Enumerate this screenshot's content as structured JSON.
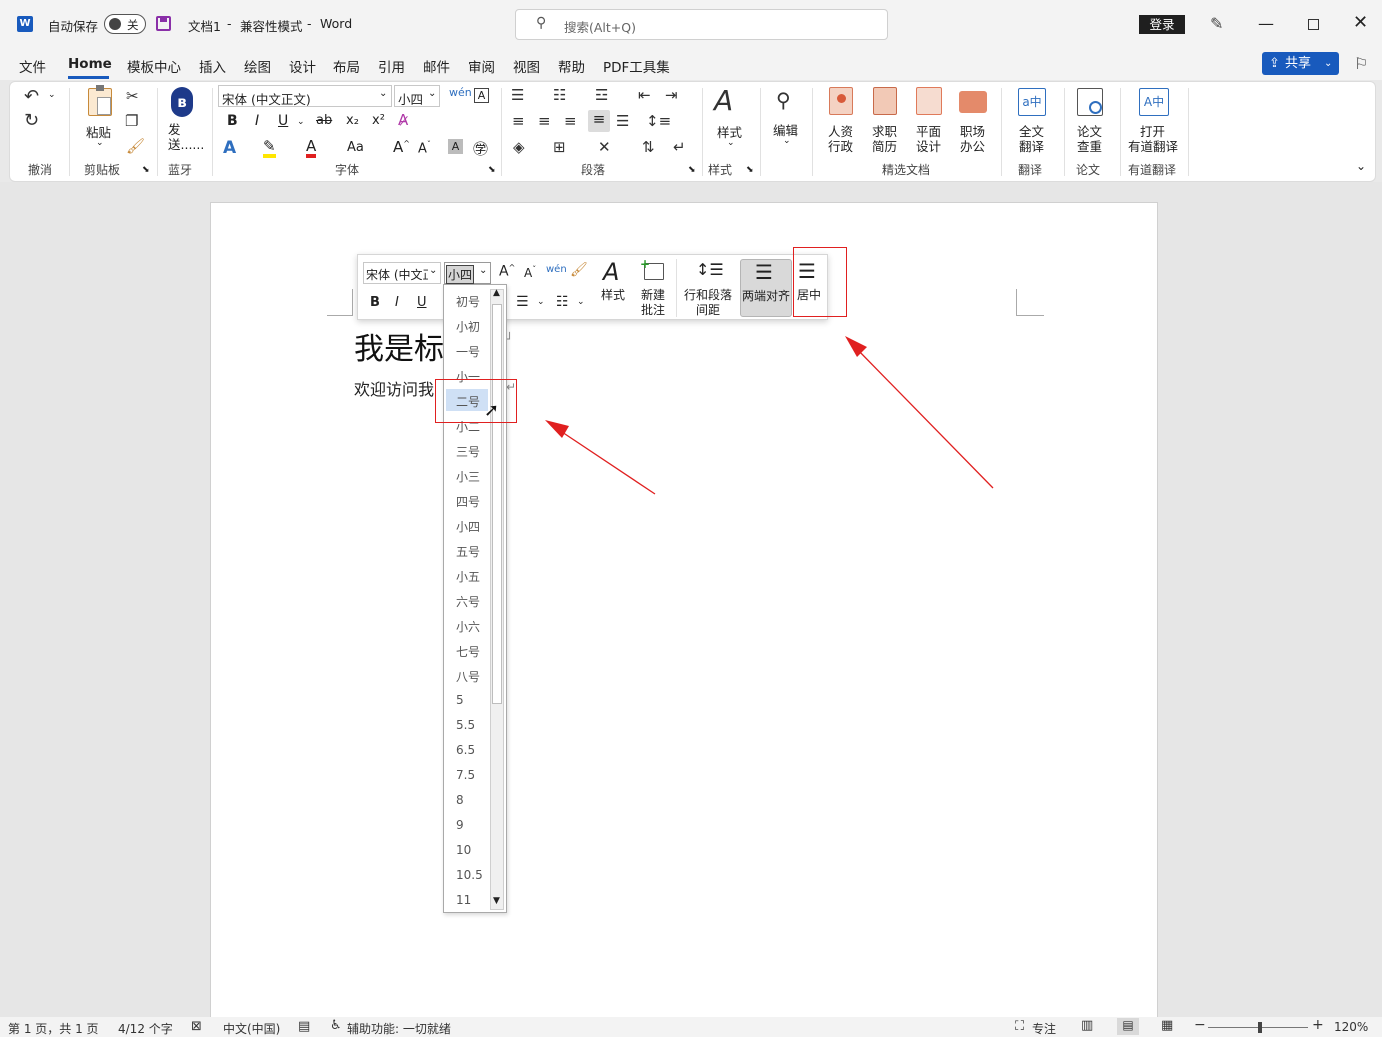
{
  "titlebar": {
    "autosave_label": "自动保存",
    "autosave_state": "关",
    "doc_title": "文档1",
    "compat": "兼容性模式",
    "app": "Word",
    "search_placeholder": "搜索(Alt+Q)",
    "login": "登录",
    "share": "共享"
  },
  "tabs": [
    "文件",
    "Home",
    "模板中心",
    "插入",
    "绘图",
    "设计",
    "布局",
    "引用",
    "邮件",
    "审阅",
    "视图",
    "帮助",
    "PDF工具集"
  ],
  "ribbon": {
    "paste": "粘贴",
    "send": "发送......",
    "font_name": "宋体 (中文正文)",
    "font_size": "小四",
    "style_btn": "样式",
    "edit_btn": "编辑",
    "jingxuan": [
      {
        "l1": "人资",
        "l2": "行政"
      },
      {
        "l1": "求职",
        "l2": "简历"
      },
      {
        "l1": "平面",
        "l2": "设计"
      },
      {
        "l1": "职场",
        "l2": "办公"
      }
    ],
    "fanyi": {
      "l1": "全文",
      "l2": "翻译"
    },
    "lunwen": {
      "l1": "论文",
      "l2": "查重"
    },
    "youdao": {
      "l1": "打开",
      "l2": "有道翻译"
    },
    "groups": {
      "undo": "撤消",
      "clipboard": "剪贴板",
      "bluetooth": "蓝牙",
      "font": "字体",
      "paragraph": "段落",
      "styles": "样式",
      "jingxuan": "精选文档",
      "fanyi": "翻译",
      "lunwen": "论文",
      "youdao": "有道翻译"
    }
  },
  "document": {
    "heading": "我是标",
    "body": "欢迎访问我"
  },
  "minitoolbar": {
    "font": "宋体 (中文正文)",
    "size": "小四",
    "style": "样式",
    "new_comment_1": "新建",
    "new_comment_2": "批注",
    "spacing_1": "行和段落",
    "spacing_2": "间距",
    "justify": "两端对齐",
    "center": "居中"
  },
  "font_size_options": [
    "初号",
    "小初",
    "一号",
    "小一",
    "二号",
    "小二",
    "三号",
    "小三",
    "四号",
    "小四",
    "五号",
    "小五",
    "六号",
    "小六",
    "七号",
    "八号",
    "5",
    "5.5",
    "6.5",
    "7.5",
    "8",
    "9",
    "10",
    "10.5",
    "11"
  ],
  "status": {
    "page": "第 1 页，共 1 页",
    "words": "4/12 个字",
    "lang": "中文(中国)",
    "access": "辅助功能: 一切就绪",
    "focus": "专注",
    "zoom": "120%"
  },
  "colors": {
    "accent": "#185abd",
    "annotation": "#e02020"
  }
}
